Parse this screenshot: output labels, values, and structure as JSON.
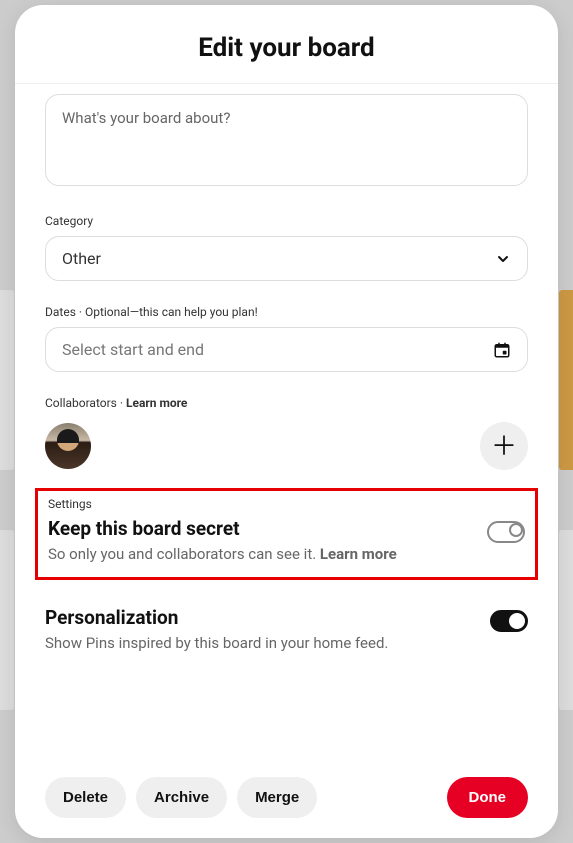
{
  "header": {
    "title": "Edit your board"
  },
  "description": {
    "placeholder": "What's your board about?"
  },
  "category": {
    "label": "Category",
    "value": "Other"
  },
  "dates": {
    "label": "Dates · Optional—this can help you plan!",
    "placeholder": "Select start and end"
  },
  "collaborators": {
    "label": "Collaborators",
    "learn_more": "Learn more"
  },
  "settings": {
    "label": "Settings",
    "secret": {
      "title": "Keep this board secret",
      "desc_prefix": "So only you and collaborators can see it. ",
      "learn_more": "Learn more",
      "on": false
    },
    "personalization": {
      "title": "Personalization",
      "desc": "Show Pins inspired by this board in your home feed.",
      "on": true
    }
  },
  "footer": {
    "delete": "Delete",
    "archive": "Archive",
    "merge": "Merge",
    "done": "Done"
  }
}
